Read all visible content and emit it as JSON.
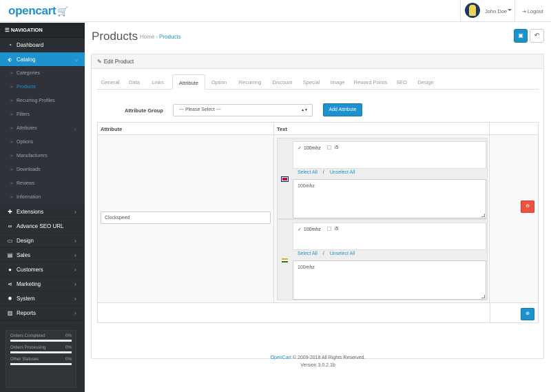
{
  "header": {
    "logo": "opencart",
    "user_name": "John Doe",
    "logout_label": "Logout"
  },
  "sidebar": {
    "nav_title": "NAVIGATION",
    "items": [
      {
        "label": "Dashboard",
        "icon": "dashboard-icon"
      },
      {
        "label": "Catalog",
        "icon": "tag-icon",
        "active": true
      },
      {
        "label": "Extensions",
        "icon": "puzzle-icon"
      },
      {
        "label": "Advance SEO URL",
        "icon": "link-icon"
      },
      {
        "label": "Design",
        "icon": "monitor-icon"
      },
      {
        "label": "Sales",
        "icon": "cart-icon"
      },
      {
        "label": "Customers",
        "icon": "user-icon"
      },
      {
        "label": "Marketing",
        "icon": "share-icon"
      },
      {
        "label": "System",
        "icon": "gear-icon"
      },
      {
        "label": "Reports",
        "icon": "bar-chart-icon"
      }
    ],
    "catalog_sub": [
      {
        "label": "Categories"
      },
      {
        "label": "Products",
        "current": true
      },
      {
        "label": "Recurring Profiles"
      },
      {
        "label": "Filters"
      },
      {
        "label": "Attributes",
        "has_children": true
      },
      {
        "label": "Options"
      },
      {
        "label": "Manufacturers"
      },
      {
        "label": "Downloads"
      },
      {
        "label": "Reviews"
      },
      {
        "label": "Information"
      }
    ],
    "stats": [
      {
        "label": "Orders Completed",
        "value": "0%",
        "fill": 0
      },
      {
        "label": "Orders Processing",
        "value": "0%",
        "fill": 0
      },
      {
        "label": "Other Statuses",
        "value": "0%",
        "fill": 0
      }
    ]
  },
  "page": {
    "title": "Products",
    "breadcrumb_home": "Home",
    "breadcrumb_sep": "›",
    "breadcrumb_current": "Products"
  },
  "panel": {
    "heading": "Edit Product",
    "tabs": [
      "General",
      "Data",
      "Links",
      "Attribute",
      "Option",
      "Recurring",
      "Discount",
      "Special",
      "Image",
      "Reward Points",
      "SEO",
      "Design"
    ],
    "active_tab": "Attribute"
  },
  "attribute_group": {
    "label": "Attribute Group",
    "select_value": "--- Please Select ---",
    "add_button": "Add Attribute"
  },
  "table": {
    "col_attribute": "Attribute",
    "col_text": "Text",
    "row": {
      "attribute_value": "Clockspeed",
      "languages": [
        {
          "flag": "uk-flag-icon",
          "options": [
            {
              "label": "100mhz",
              "checked": true
            },
            {
              "label": "i5",
              "checked": false
            }
          ],
          "select_all": "Select All",
          "slash": "/",
          "unselect_all": "Unselect All",
          "text": "100mhz"
        },
        {
          "flag": "india-flag-icon",
          "options": [
            {
              "label": "100mhz",
              "checked": true
            },
            {
              "label": "i5",
              "checked": false
            }
          ],
          "select_all": "Select All",
          "slash": "/",
          "unselect_all": "Unselect All",
          "text": "100mhz"
        }
      ]
    }
  },
  "footer": {
    "brand": "OpenCart",
    "copyright": "© 2009-2018 All Rights Reserved.",
    "version": "Version 3.0.2.1b"
  },
  "colors": {
    "primary": "#1e91cf",
    "danger": "#e8543f",
    "sidebar": "#2b2e33"
  }
}
